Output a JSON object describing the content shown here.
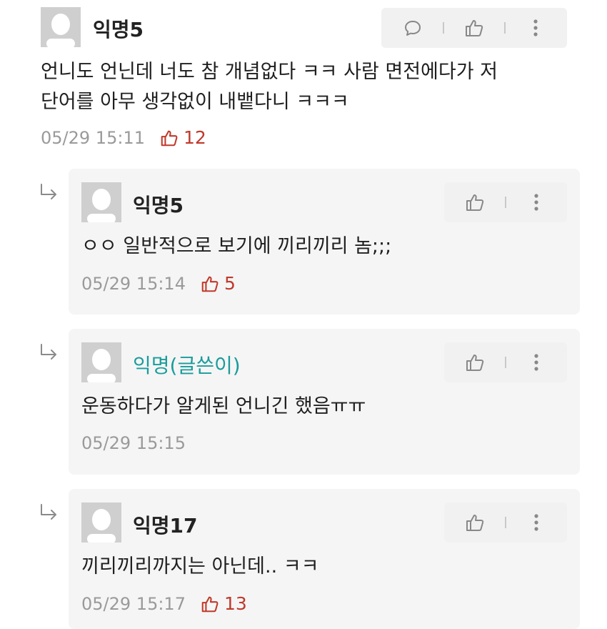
{
  "comments": [
    {
      "author": "익명5",
      "lines": [
        "언니도 언닌데 너도 참 개념없다 ㅋㅋ 사람 면전에다가 저",
        "단어를 아무 생각없이 내뱉다니 ㅋㅋㅋ"
      ],
      "time": "05/29 15:11",
      "likes": "12"
    }
  ],
  "replies": [
    {
      "author": "익명5",
      "text": "ㅇㅇ 일반적으로 보기에 끼리끼리 놈;;;",
      "time": "05/29 15:14",
      "likes": "5"
    },
    {
      "author": "익명(글쓴이)",
      "text": "운동하다가 알게된 언니긴 했음ㅠㅠ",
      "time": "05/29 15:15",
      "likes": ""
    },
    {
      "author": "익명17",
      "text": "끼리끼리까지는 아닌데..  ㅋㅋ",
      "time": "05/29 15:17",
      "likes": "13"
    }
  ],
  "icons": {
    "reply": "speech-bubble-icon",
    "like": "thumbs-up-icon",
    "more": "more-vertical-icon",
    "reply_arrow": "reply-arrow-icon",
    "avatar": "default-avatar-icon"
  },
  "colors": {
    "like_count": "#c0392b",
    "op_author": "#1a9c9c",
    "meta": "#9a9a9a",
    "card_bg": "#f5f5f5"
  }
}
